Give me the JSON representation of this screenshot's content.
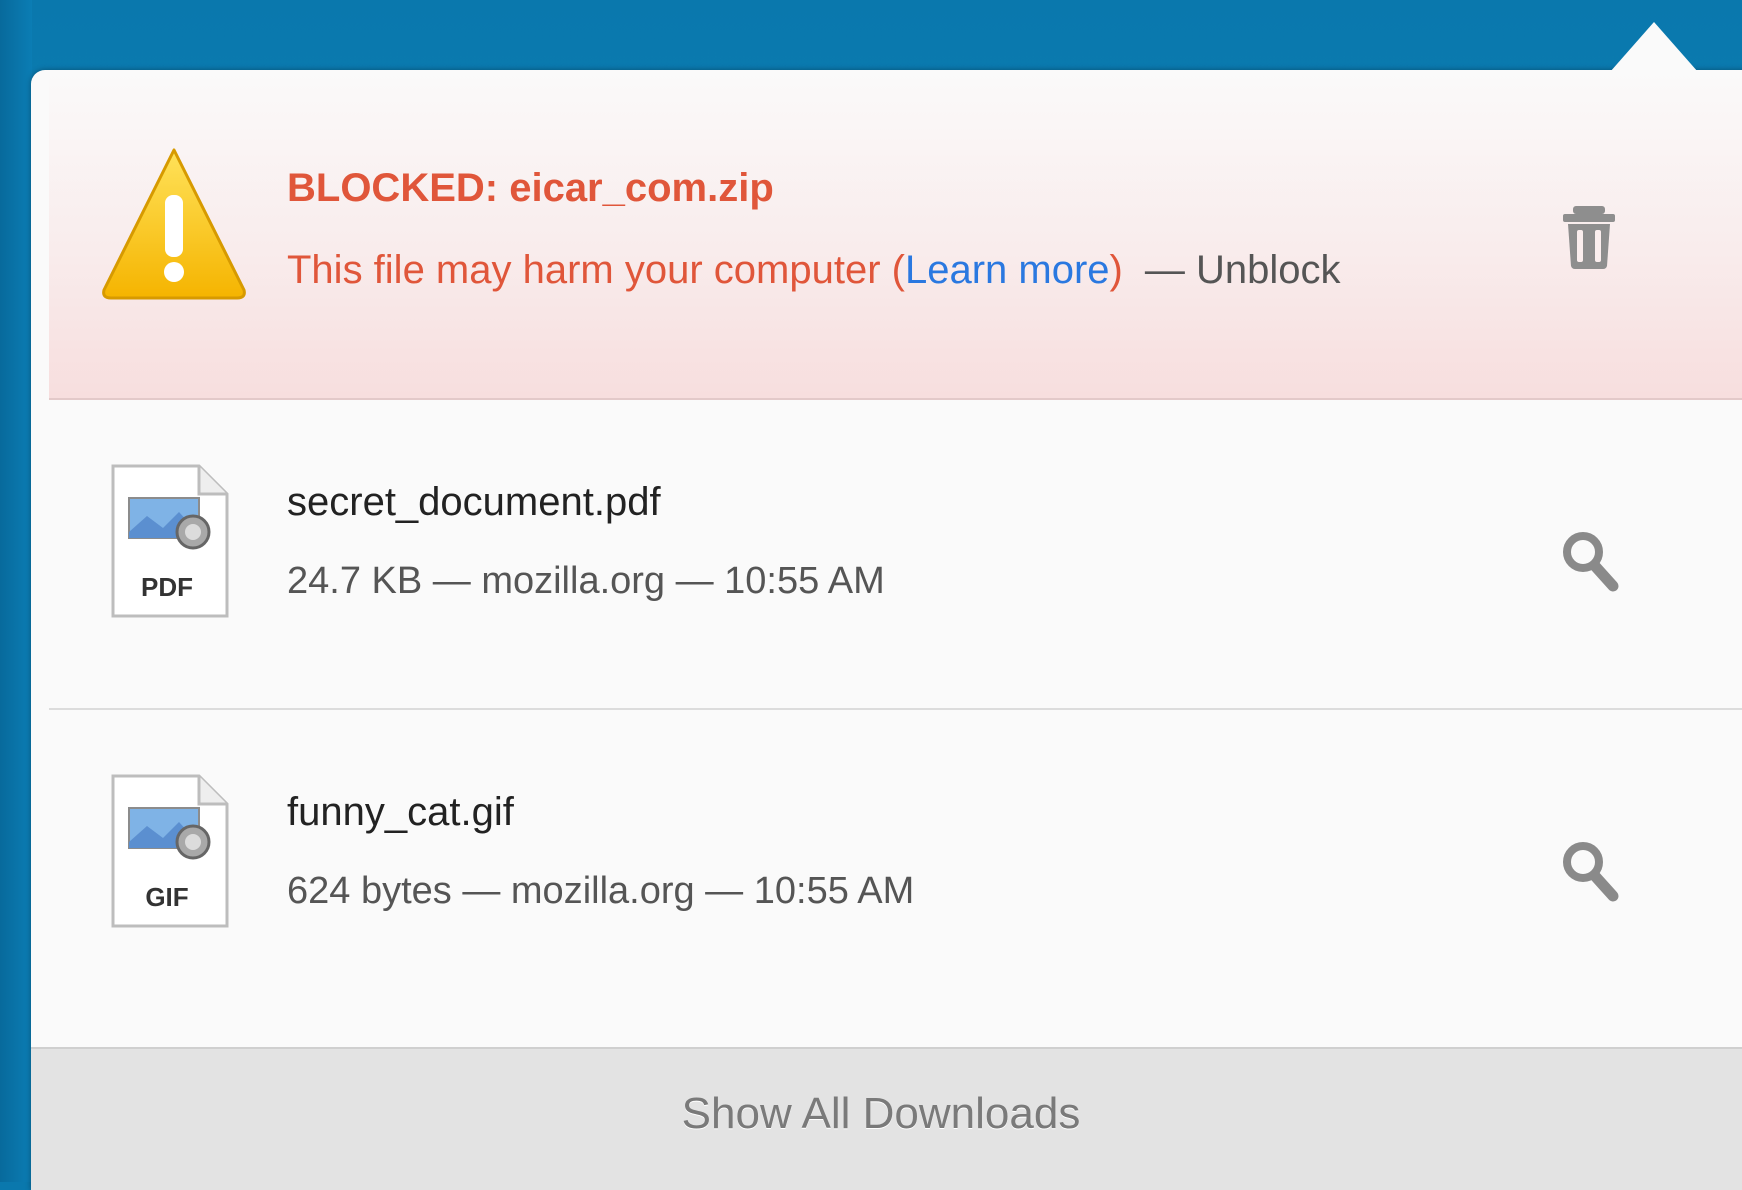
{
  "downloads": [
    {
      "status": "blocked",
      "title": "BLOCKED: eicar_com.zip",
      "message": "This file may harm your computer (",
      "learn_more": "Learn more",
      "message_close": ")",
      "unblock": "— Unblock",
      "icon": "warning-icon",
      "action_icon": "trash-icon"
    },
    {
      "status": "complete",
      "title": "secret_document.pdf",
      "details": "24.7 KB — mozilla.org — 10:55 AM",
      "file_type": "PDF",
      "icon": "pdf-file-icon",
      "action_icon": "magnifier-icon"
    },
    {
      "status": "complete",
      "title": "funny_cat.gif",
      "details": "624 bytes — mozilla.org — 10:55 AM",
      "file_type": "GIF",
      "icon": "gif-file-icon",
      "action_icon": "magnifier-icon"
    }
  ],
  "footer": {
    "label": "Show All Downloads"
  },
  "colors": {
    "blocked_text": "#e0563a",
    "link": "#2a78e0",
    "background_blue": "#0a78ad"
  }
}
